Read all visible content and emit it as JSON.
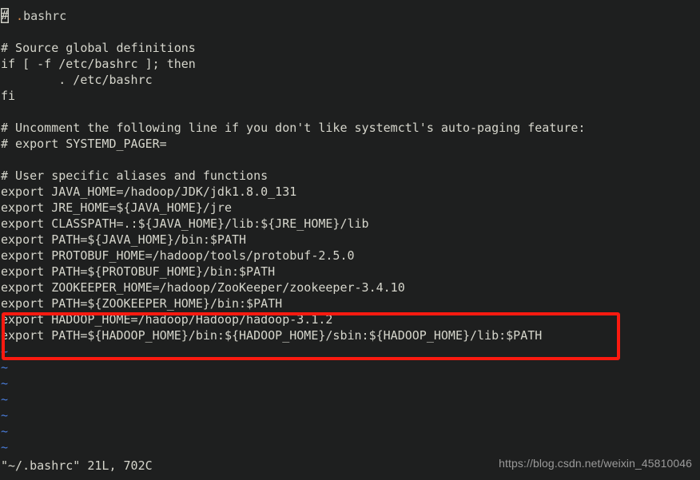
{
  "window": {
    "background_color": "#1e1f1f",
    "foreground_color": "#d6d6cc",
    "tilde_color": "#4a7ddb",
    "accent_color": "#fa1a10",
    "watermark_color": "#9a9a9a"
  },
  "editor": {
    "app": "vim",
    "file_title": ".bashrc",
    "cursor_char": "#",
    "lines": [
      {
        "id": 1,
        "text": "# .bashrc",
        "type": "comment",
        "cursor": true
      },
      {
        "id": 2,
        "text": "",
        "type": "blank"
      },
      {
        "id": 3,
        "text": "# Source global definitions",
        "type": "comment"
      },
      {
        "id": 4,
        "text": "if [ -f /etc/bashrc ]; then",
        "type": "code"
      },
      {
        "id": 5,
        "text": "        . /etc/bashrc",
        "type": "code"
      },
      {
        "id": 6,
        "text": "fi",
        "type": "code"
      },
      {
        "id": 7,
        "text": "",
        "type": "blank"
      },
      {
        "id": 8,
        "text": "# Uncomment the following line if you don't like systemctl's auto-paging feature:",
        "type": "comment"
      },
      {
        "id": 9,
        "text": "# export SYSTEMD_PAGER=",
        "type": "comment"
      },
      {
        "id": 10,
        "text": "",
        "type": "blank"
      },
      {
        "id": 11,
        "text": "# User specific aliases and functions",
        "type": "comment"
      },
      {
        "id": 12,
        "text": "export JAVA_HOME=/hadoop/JDK/jdk1.8.0_131",
        "type": "code"
      },
      {
        "id": 13,
        "text": "export JRE_HOME=${JAVA_HOME}/jre",
        "type": "code"
      },
      {
        "id": 14,
        "text": "export CLASSPATH=.:${JAVA_HOME}/lib:${JRE_HOME}/lib",
        "type": "code"
      },
      {
        "id": 15,
        "text": "export PATH=${JAVA_HOME}/bin:$PATH",
        "type": "code"
      },
      {
        "id": 16,
        "text": "export PROTOBUF_HOME=/hadoop/tools/protobuf-2.5.0",
        "type": "code"
      },
      {
        "id": 17,
        "text": "export PATH=${PROTOBUF_HOME}/bin:$PATH",
        "type": "code"
      },
      {
        "id": 18,
        "text": "export ZOOKEEPER_HOME=/hadoop/ZooKeeper/zookeeper-3.4.10",
        "type": "code"
      },
      {
        "id": 19,
        "text": "export PATH=${ZOOKEEPER_HOME}/bin:$PATH",
        "type": "code"
      },
      {
        "id": 20,
        "text": "export HADOOP_HOME=/hadoop/Hadoop/hadoop-3.1.2",
        "type": "code",
        "highlighted": true
      },
      {
        "id": 21,
        "text": "export PATH=${HADOOP_HOME}/bin:${HADOOP_HOME}/sbin:${HADOOP_HOME}/lib:$PATH",
        "type": "code",
        "highlighted": true
      }
    ],
    "empty_markers": [
      "~",
      "~",
      "~",
      "~",
      "~",
      "~",
      "~"
    ],
    "status_line": "\"~/.bashrc\" 21L, 702C",
    "status_file": "~/.bashrc",
    "status_line_count": "21L",
    "status_char_count": "702C"
  },
  "annotation": {
    "shape": "rectangle",
    "color": "#fa1a10",
    "covers_lines": "20-21"
  },
  "watermark": {
    "text": "https://blog.csdn.net/weixin_45810046"
  }
}
